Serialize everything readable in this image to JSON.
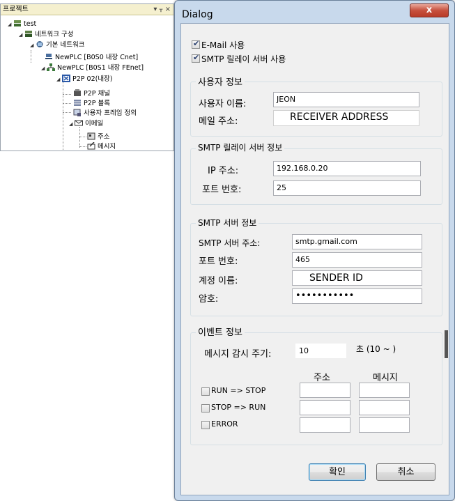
{
  "project_panel": {
    "title": "프로젝트",
    "controls": "▾ ᚁ ×",
    "tree": [
      {
        "label": "test",
        "icon": "project-icon"
      },
      {
        "label": "네트워크 구성",
        "icon": "network-config-icon"
      },
      {
        "label": "기본 네트워크",
        "icon": "network-icon"
      },
      {
        "label": "NewPLC [B0S0 내장 Cnet]",
        "icon": "plc-cnet-icon"
      },
      {
        "label": "NewPLC [B0S1 내장 FEnet]",
        "icon": "plc-fenet-icon"
      },
      {
        "label": "P2P 02(내장)",
        "icon": "p2p-icon"
      },
      {
        "label": "P2P 채널",
        "icon": "channel-icon"
      },
      {
        "label": "P2P 블록",
        "icon": "block-icon"
      },
      {
        "label": "사용자 프레임 정의",
        "icon": "frame-icon"
      },
      {
        "label": "이메일",
        "icon": "email-icon"
      },
      {
        "label": "주소",
        "icon": "address-icon"
      },
      {
        "label": "메시지",
        "icon": "message-icon"
      }
    ]
  },
  "dialog": {
    "title": "Dialog",
    "close_label": "x",
    "email_use": {
      "label": "E-Mail 사용",
      "checked": true
    },
    "smtp_relay_use": {
      "label": "SMTP 릴레이 서버 사용",
      "checked": true
    },
    "user_info": {
      "title": "사용자 정보",
      "name_label": "사용자 이름:",
      "name_value": "JEON",
      "email_label": "메일 주소:",
      "email_value": "RECEIVER ADDRESS"
    },
    "relay_info": {
      "title": "SMTP 릴레이 서버 정보",
      "ip_label": "IP 주소:",
      "ip_value": "192.168.0.20",
      "port_label": "포트 번호:",
      "port_value": "25"
    },
    "smtp_info": {
      "title": "SMTP 서버 정보",
      "addr_label": "SMTP 서버 주소:",
      "addr_value": "smtp.gmail.com",
      "port_label": "포트 번호:",
      "port_value": "465",
      "account_label": "계정 이름:",
      "account_value": "SENDER ID",
      "password_label": "암호:",
      "password_value": "•••••••••••"
    },
    "event_info": {
      "title": "이벤트 정보",
      "interval_label": "메시지 감시 주기:",
      "interval_value": "10",
      "interval_unit": "초 (10 ~ )",
      "col_address": "주소",
      "col_message": "메시지",
      "rows": [
        {
          "label": "RUN => STOP",
          "checked": false
        },
        {
          "label": "STOP => RUN",
          "checked": false
        },
        {
          "label": "ERROR",
          "checked": false
        }
      ]
    },
    "ok_label": "확인",
    "cancel_label": "취소"
  }
}
